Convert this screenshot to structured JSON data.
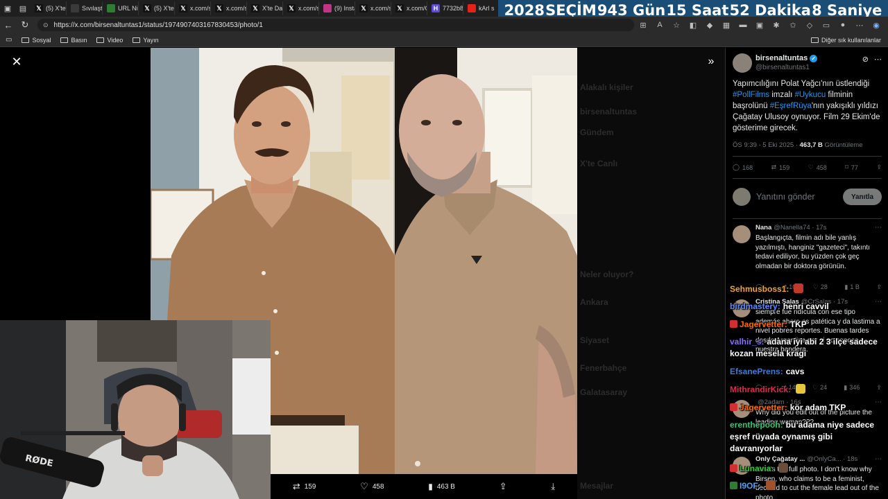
{
  "tabs": [
    {
      "label": "(5) X'te",
      "icon": "x-icon",
      "color": "#111111"
    },
    {
      "label": "Sıvılaştı",
      "icon": "globe-icon",
      "color": "#3a3a3a"
    },
    {
      "label": "URL Nir",
      "icon": "url-icon",
      "color": "#2e7d32"
    },
    {
      "label": "(5) X'te",
      "icon": "x-icon",
      "color": "#111111"
    },
    {
      "label": "x.com/s",
      "icon": "x-icon",
      "color": "#111111"
    },
    {
      "label": "x.com/s",
      "icon": "x-icon",
      "color": "#111111"
    },
    {
      "label": "X'te Da",
      "icon": "x-icon",
      "color": "#111111"
    },
    {
      "label": "x.com/s",
      "icon": "x-icon",
      "color": "#111111"
    },
    {
      "label": "(9) Insta",
      "icon": "instagram-icon",
      "color": "#c13584"
    },
    {
      "label": "x.com/s",
      "icon": "x-icon",
      "color": "#111111"
    },
    {
      "label": "x.com/C",
      "icon": "x-icon",
      "color": "#111111"
    },
    {
      "label": "7732b8",
      "icon": "h-icon",
      "color": "#5c4bd6"
    },
    {
      "label": "kArl s",
      "icon": "youtube-icon",
      "color": "#e62117"
    }
  ],
  "countdown": {
    "year": "2028",
    "label": "SEÇİM",
    "days": "943 Gün",
    "hours": "15 Saat",
    "minutes": "52 Dakika",
    "seconds": "8 Saniye"
  },
  "address": {
    "url": "https://x.com/birsenaltuntas1/status/1974907403167830453/photo/1"
  },
  "bookmarks": {
    "items": [
      "Sosyal",
      "Basın",
      "Video",
      "Yayın"
    ],
    "other": "Diğer sık kullanılanlar"
  },
  "photo_actions": {
    "retweets": "159",
    "likes": "458",
    "views": "463 B"
  },
  "background_sidebar": {
    "lines": [
      "Alakalı kişiler",
      "birsenaltuntas",
      "Gündem",
      "X'te Canlı",
      "Neler oluyor?",
      "Ankara",
      "Siyaset",
      "Fenerbahçe",
      "Galatasaray",
      "Mesajlar"
    ]
  },
  "tweet": {
    "author_name": "birsenaltuntas",
    "author_handle": "@birsenaltuntas1",
    "text_1": "Yapımcılığını Polat Yağcı'nın üstlendiği ",
    "tag_1": "#PollFilms",
    "text_2": " imzalı ",
    "tag_2": "#Uykucu",
    "text_3": " filminin başrolünü ",
    "tag_3": "#EşrefRüya",
    "text_4": "'nın yakışıklı yıldızı Çağatay Ulusoy oynuyor. Film 29 Ekim'de gösterime girecek.",
    "time": "ÖS 9:39 - 5 Eki 2025 · ",
    "views_count": "463,7 B",
    "views_label": " Görüntüleme",
    "stats": {
      "replies": "168",
      "retweets": "159",
      "likes": "458",
      "bookmarks": "77"
    },
    "reply_placeholder": "Yanıtını gönder",
    "reply_button": "Yanıtla"
  },
  "replies": [
    {
      "name": "Nana",
      "handle": "@Nanella74 · 17s",
      "text": "Başlangıçta, filmin adı bile yanlış yazılmıştı, hanginiz \"gazeteci\", takıntı tedavi ediliyor, bu yüzden çok geç olmadan bir doktora görünün.",
      "replies": "",
      "retweets": "10",
      "likes": "28",
      "views": "1 B"
    },
    {
      "name": "Cristina Salas",
      "handle": "@CrSalas · 17s",
      "text": "siempre fue ridícula con ese tipo además ahora es patética y da lastima a nivel pobres reportes. Buenas tardes desde Argentina por si no conoce nuestra bandera.",
      "replies": "",
      "retweets": "14",
      "likes": "24",
      "views": "346"
    },
    {
      "name": "",
      "handle": "@2adam · 16s",
      "text": "Why did you edit out of the picture the leading woman???",
      "replies": "",
      "retweets": "",
      "likes": "",
      "views": ""
    },
    {
      "name": "Only Çağatay ...",
      "handle": "@OnlyCa... · 18s",
      "text": "Here's the full photo. I don't know why Birsen, who claims to be a feminist, decided to cut the female lead out of the photo.",
      "replies": "",
      "retweets": "",
      "likes": "",
      "views": ""
    }
  ],
  "chat": [
    {
      "user": "Sehmusboss1:",
      "color": "#f0a530",
      "msg": "",
      "badge": "",
      "emote": "#c0392b"
    },
    {
      "user": "birdmastery:",
      "color": "#5b8cff",
      "msg": "henri cavvil",
      "badge": "",
      "emote": ""
    },
    {
      "user": "Jagervetter:",
      "color": "#ff6a00",
      "msg": "TKP",
      "badge": "#d32f2f",
      "emote": ""
    },
    {
      "user": "valhir_s:",
      "color": "#8a6bff",
      "msg": "adana iyi abi 2 3 ilçe sadece kozan mesela kragi",
      "badge": "",
      "emote": ""
    },
    {
      "user": "EfsanePrens:",
      "color": "#3a7bd5",
      "msg": "cavs",
      "badge": "",
      "emote": ""
    },
    {
      "user": "MithrandirKick:",
      "color": "#e0284a",
      "msg": "",
      "badge": "",
      "emote": "#e6c63a"
    },
    {
      "user": "Jagervetter:",
      "color": "#ff6a00",
      "msg": "kör adam TKP",
      "badge": "#d32f2f",
      "emote": ""
    },
    {
      "user": "erenthepooh:",
      "color": "#2ecc71",
      "msg": "bu adama niye sadece eşref rüyada oynamış gibi davranıyorlar",
      "badge": "",
      "emote": ""
    },
    {
      "user": "Lunavia:",
      "color": "#33cc33",
      "msg": "",
      "badge": "#d32f2f",
      "emote": "#6a4e3a"
    },
    {
      "user": "I9OF:",
      "color": "#4aa3ff",
      "msg": "",
      "badge": "#2e7d32",
      "emote": "#a0522d"
    }
  ],
  "webcam": {
    "mic_brand": "RØDE"
  },
  "colors": {
    "accent": "#1d9bf0",
    "countdown_bg": "#1a4e76"
  }
}
